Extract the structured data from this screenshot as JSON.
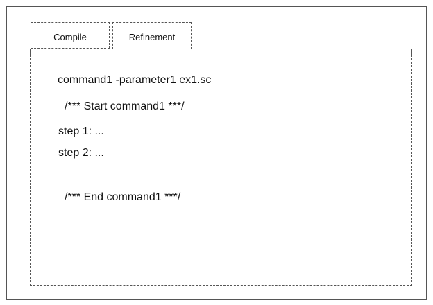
{
  "tabs": [
    {
      "label": "Compile",
      "active": false
    },
    {
      "label": "Refinement",
      "active": true
    }
  ],
  "content": {
    "lines": [
      "command1 -parameter1 ex1.sc",
      "/*** Start command1 ***/",
      "step 1: ...",
      "step 2: ...",
      "/*** End command1 ***/"
    ]
  },
  "colors": {
    "border": "#555555",
    "text": "#111111",
    "background": "#ffffff"
  }
}
